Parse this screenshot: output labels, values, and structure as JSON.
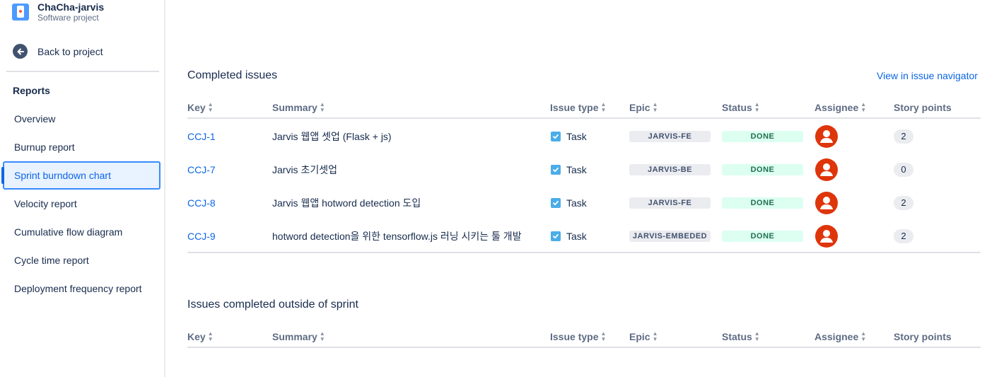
{
  "project": {
    "name": "ChaCha-jarvis",
    "type": "Software project"
  },
  "back_label": "Back to project",
  "reports_heading": "Reports",
  "nav_items": [
    {
      "label": "Overview"
    },
    {
      "label": "Burnup report"
    },
    {
      "label": "Sprint burndown chart",
      "active": true
    },
    {
      "label": "Velocity report"
    },
    {
      "label": "Cumulative flow diagram"
    },
    {
      "label": "Cycle time report"
    },
    {
      "label": "Deployment frequency report"
    }
  ],
  "completed": {
    "title": "Completed issues",
    "view_link": "View in issue navigator",
    "columns": {
      "key": "Key",
      "summary": "Summary",
      "issue_type": "Issue type",
      "epic": "Epic",
      "status": "Status",
      "assignee": "Assignee",
      "story_points": "Story points"
    },
    "rows": [
      {
        "key": "CCJ-1",
        "summary": "Jarvis 웹앱 셋업 (Flask + js)",
        "type": "Task",
        "epic": "JARVIS-FE",
        "status": "DONE",
        "points": "2"
      },
      {
        "key": "CCJ-7",
        "summary": "Jarvis 초기셋업",
        "type": "Task",
        "epic": "JARVIS-BE",
        "status": "DONE",
        "points": "0"
      },
      {
        "key": "CCJ-8",
        "summary": "Jarvis 웹앱 hotword detection 도입",
        "type": "Task",
        "epic": "JARVIS-FE",
        "status": "DONE",
        "points": "2"
      },
      {
        "key": "CCJ-9",
        "summary": "hotword detection을 위한 tensorflow.js 러닝 시키는 툴 개발",
        "type": "Task",
        "epic": "JARVIS-EMBEDED",
        "status": "DONE",
        "points": "2"
      }
    ]
  },
  "outside": {
    "title": "Issues completed outside of sprint",
    "columns": {
      "key": "Key",
      "summary": "Summary",
      "issue_type": "Issue type",
      "epic": "Epic",
      "status": "Status",
      "assignee": "Assignee",
      "story_points": "Story points"
    }
  },
  "colors": {
    "link": "#0C66E4",
    "done_bg": "#DCFFF1",
    "done_text": "#216E4E",
    "avatar": "#DE350B",
    "task_icon": "#4BADE8"
  }
}
